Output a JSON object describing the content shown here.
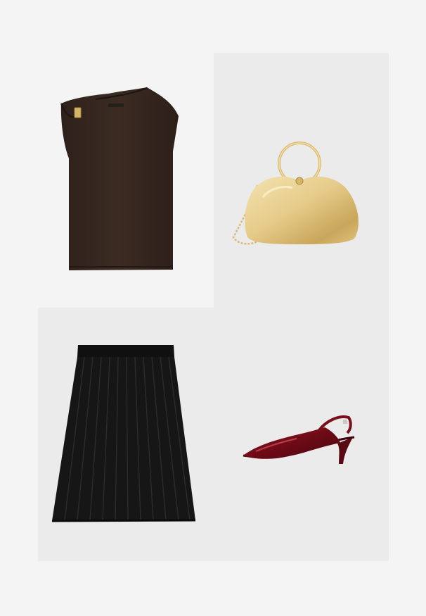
{
  "outfit": {
    "items": [
      {
        "id": "top",
        "image": "brown-sleeveless-top",
        "color": "#3a2a22"
      },
      {
        "id": "bag",
        "image": "gold-round-handle-clutch",
        "color": "#e3c98a"
      },
      {
        "id": "skirt",
        "image": "black-pleated-skirt",
        "color": "#151515"
      },
      {
        "id": "shoe",
        "image": "burgundy-slingback-heel",
        "color": "#7e0f1b"
      }
    ],
    "colors": {
      "background": "#f4f4f4",
      "tile_gray": "#ebebeb"
    }
  }
}
